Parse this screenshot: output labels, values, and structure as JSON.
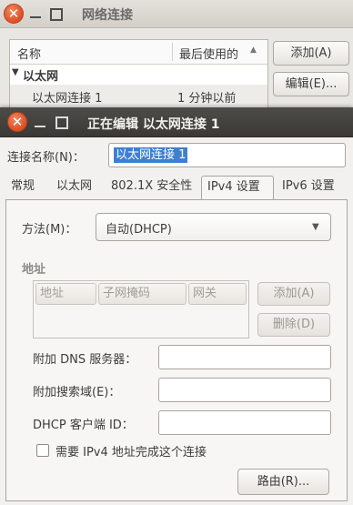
{
  "background_window": {
    "title": "网络连接",
    "columns": [
      "名称",
      "最后使用的"
    ],
    "group": "以太网",
    "connection": {
      "name": "以太网连接 1",
      "last_used": "1 分钟以前"
    },
    "buttons": {
      "add": "添加(A)",
      "edit": "编辑(E)..."
    }
  },
  "dialog": {
    "title": "正在编辑 以太网连接 1",
    "connection_name_label": "连接名称(N)：",
    "connection_name_value": "以太网连接 1",
    "tabs": [
      "常规",
      "以太网",
      "802.1X 安全性",
      "IPv4 设置",
      "IPv6 设置"
    ],
    "active_tab": "IPv4 设置",
    "method_label": "方法(M)：",
    "method_value": "自动(DHCP)",
    "address_section": "地址",
    "address_columns": [
      "地址",
      "子网掩码",
      "网关"
    ],
    "add_button": "添加(A)",
    "delete_button": "删除(D)",
    "dns_label": "附加 DNS 服务器：",
    "search_domain_label": "附加搜索域(E)：",
    "dhcp_client_id_label": "DHCP 客户端 ID：",
    "require_ipv4_label": "需要 IPv4 地址完成这个连接",
    "require_ipv4_checked": false,
    "routes_button": "路由(R)..."
  },
  "icons": {
    "close": "close-icon",
    "minimize": "minimize-icon",
    "maximize": "maximize-icon",
    "dropdown": "dropdown-arrow-icon",
    "expander": "expander-triangle-icon",
    "sort": "sort-ascending-icon"
  },
  "colors": {
    "accent_close": "#e2552a",
    "selection": "#3e7fd0",
    "dialog_titlebar": "#3c3b37"
  }
}
